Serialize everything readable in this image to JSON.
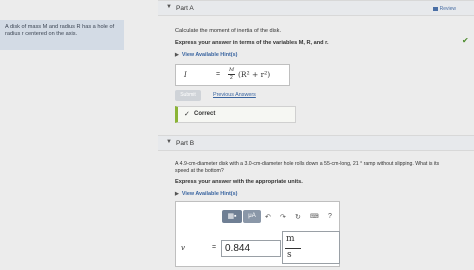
{
  "problem": {
    "text_line1": "A disk of mass M and radius R has a hole of",
    "text_line2": "radius r centered on the axis."
  },
  "review": {
    "label": "Review"
  },
  "part_a": {
    "label": "Part A",
    "question": "Calculate the moment of inertia of the disk.",
    "instruction": "Express your answer in terms of the variables M, R, and r.",
    "hints_label": "View Available Hint(s)",
    "answer_lhs": "I",
    "answer_eq": "=",
    "answer_coef_num": "M",
    "answer_coef_den": "2",
    "answer_expr": "(R² + r²)",
    "submit_label": "Submit",
    "previous_answers_label": "Previous Answers",
    "correct_label": "Correct",
    "status": "correct"
  },
  "part_b": {
    "label": "Part B",
    "question_line1": "A 4.9-cm-diameter disk with a 3.0-cm-diameter hole rolls down a 55-cm-long, 21 ° ramp without slipping. What is its",
    "question_line2": "speed at the bottom?",
    "instruction": "Express your answer with the appropriate units.",
    "hints_label": "View Available Hint(s)",
    "answer_lhs": "v",
    "answer_eq": "=",
    "answer_value": "0.844",
    "unit_num": "m",
    "unit_den": "s",
    "toolbar": {
      "templates_icon": "templates-icon",
      "units_label": "μA",
      "undo_icon": "undo-icon",
      "redo_icon": "redo-icon",
      "reset_icon": "reset-icon",
      "keyboard_icon": "keyboard-icon",
      "help_label": "?"
    }
  },
  "colors": {
    "accent": "#4a6fa5",
    "correct_green": "#8bb436",
    "toolbar_dark": "#6f7f94"
  }
}
